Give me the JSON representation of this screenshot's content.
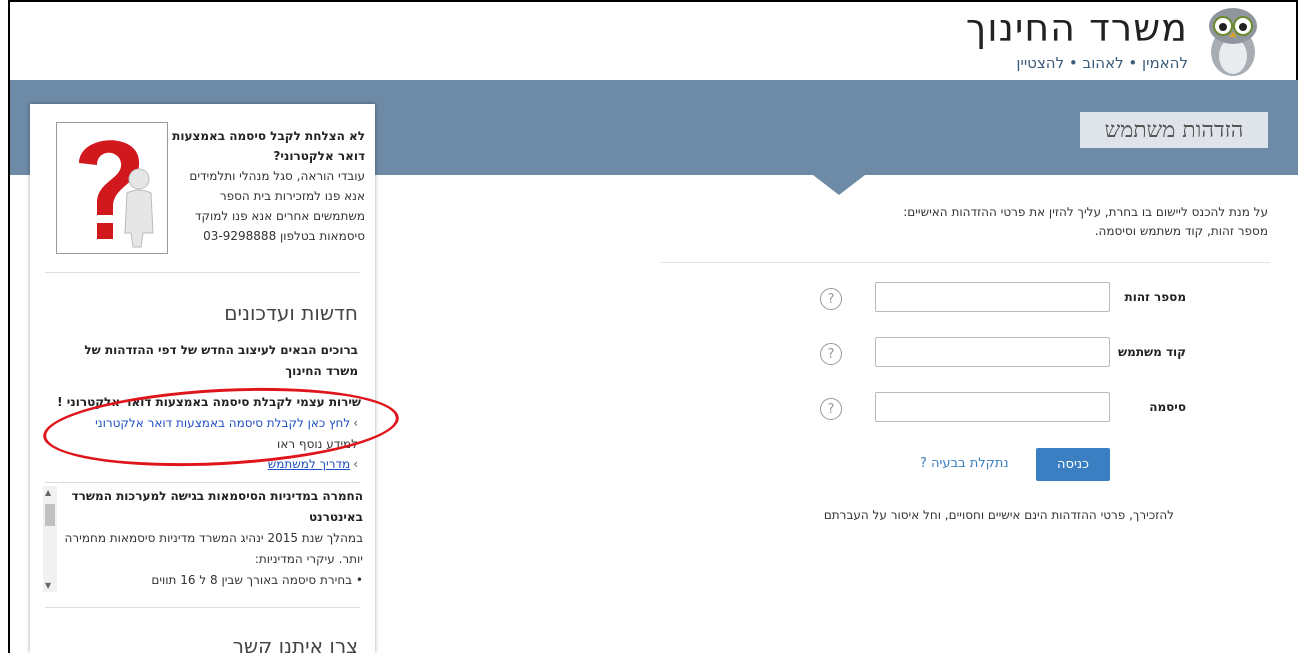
{
  "header": {
    "title": "משרד החינוך",
    "tagline": "להאמין • לאהוב • להצטיין"
  },
  "page_title": "הזדהות משתמש",
  "sidebar": {
    "promo": {
      "heading": "לא הצלחת לקבל סיסמה באמצעות דואר אלקטרוני?",
      "line1": "עובדי הוראה, סגל מנהלי ותלמידים",
      "line2": "אנא פנו למזכירות בית הספר",
      "line3": "משתמשים אחרים אנא פנו למוקד",
      "line4": "סיסמאות בטלפון 03-9298888"
    },
    "news": {
      "title": "חדשות ועדכונים",
      "welcome": "ברוכים הבאים לעיצוב החדש של דפי ההזדהות של משרד החינוך",
      "service": "שירות עצמי לקבלת סיסמה באמצעות דואר אלקטרוני !",
      "link1": "לחץ כאן לקבלת סיסמה באמצעות דואר אלקטרוני",
      "info": "למידע נוסף ראו",
      "link2": "מדריך למשתמש",
      "scroll_heading": "החמרה במדיניות הסיסמאות בגישה למערכות המשרד באינטרנט",
      "scroll_body": "במהלך שנת 2015 ינהיג המשרד מדיניות סיסמאות מחמירה יותר. עיקרי המדיניות:",
      "scroll_bullet": "בחירת סיסמה באורך שבין 8 ל 16 תווים"
    },
    "contact_title": "צרו איתנו קשר"
  },
  "form": {
    "intro_line1": "על מנת להכנס ליישום בו בחרת, עליך להזין את פרטי ההזדהות האישיים:",
    "intro_line2": "מספר זהות, קוד משתמש וסיסמה.",
    "id_label": "מספר זהות",
    "id_value": "",
    "user_label": "קוד משתמש",
    "user_value": "",
    "password_label": "סיסמה",
    "password_value": "",
    "help_glyph": "?",
    "login_label": "כניסה",
    "problem_link": "נתקלת בבעיה ?",
    "reminder": "להזכירך, פרטי ההזדהות הינם אישיים וחסויים, וחל איסור על העברתם"
  },
  "colors": {
    "band": "#6d8aa6",
    "button": "#3a7fc1",
    "link": "#1e4fc2",
    "annotation": "#e0141b"
  }
}
